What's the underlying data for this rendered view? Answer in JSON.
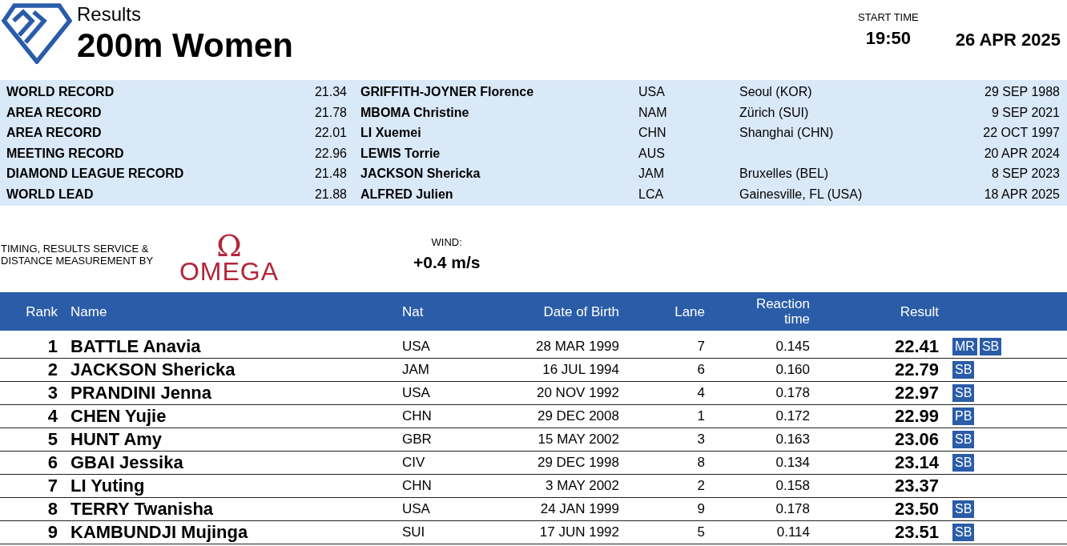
{
  "header": {
    "subtitle": "Results",
    "title": "200m Women",
    "start_time_label": "START TIME",
    "start_time": "19:50",
    "date": "26 APR 2025"
  },
  "records": [
    {
      "label": "WORLD RECORD",
      "mark": "21.34",
      "athlete": "GRIFFITH-JOYNER Florence",
      "nat": "USA",
      "venue": "Seoul (KOR)",
      "date": "29 SEP 1988"
    },
    {
      "label": "AREA RECORD",
      "mark": "21.78",
      "athlete": "MBOMA Christine",
      "nat": "NAM",
      "venue": "Zürich (SUI)",
      "date": "9 SEP 2021"
    },
    {
      "label": "AREA RECORD",
      "mark": "22.01",
      "athlete": "LI Xuemei",
      "nat": "CHN",
      "venue": "Shanghai (CHN)",
      "date": "22 OCT 1997"
    },
    {
      "label": "MEETING RECORD",
      "mark": "22.96",
      "athlete": "LEWIS Torrie",
      "nat": "AUS",
      "date": "20 APR 2024"
    },
    {
      "label": "DIAMOND LEAGUE RECORD",
      "mark": "21.48",
      "athlete": "JACKSON Shericka",
      "nat": "JAM",
      "venue": "Bruxelles (BEL)",
      "date": "8 SEP 2023"
    },
    {
      "label": "WORLD LEAD",
      "mark": "21.88",
      "athlete": "ALFRED Julien",
      "nat": "LCA",
      "venue": "Gainesville, FL (USA)",
      "date": "18 APR 2025"
    }
  ],
  "sponsor": {
    "text": "TIMING, RESULTS SERVICE & DISTANCE MEASUREMENT BY",
    "symbol": "Ω",
    "name": "OMEGA"
  },
  "wind": {
    "label": "WIND:",
    "value": "+0.4 m/s"
  },
  "table": {
    "columns": [
      "Rank",
      "Name",
      "Nat",
      "Date of Birth",
      "Lane",
      "Reaction time",
      "Result"
    ],
    "rows": [
      {
        "rank": "1",
        "name": "BATTLE Anavia",
        "nat": "USA",
        "dob": "28 MAR 1999",
        "lane": "7",
        "reaction": "0.145",
        "result": "22.41",
        "marks": [
          "MR",
          "SB"
        ]
      },
      {
        "rank": "2",
        "name": "JACKSON Shericka",
        "nat": "JAM",
        "dob": "16 JUL 1994",
        "lane": "6",
        "reaction": "0.160",
        "result": "22.79",
        "marks": [
          "SB"
        ]
      },
      {
        "rank": "3",
        "name": "PRANDINI Jenna",
        "nat": "USA",
        "dob": "20 NOV 1992",
        "lane": "4",
        "reaction": "0.178",
        "result": "22.97",
        "marks": [
          "SB"
        ]
      },
      {
        "rank": "4",
        "name": "CHEN Yujie",
        "nat": "CHN",
        "dob": "29 DEC 2008",
        "lane": "1",
        "reaction": "0.172",
        "result": "22.99",
        "marks": [
          "PB"
        ]
      },
      {
        "rank": "5",
        "name": "HUNT Amy",
        "nat": "GBR",
        "dob": "15 MAY 2002",
        "lane": "3",
        "reaction": "0.163",
        "result": "23.06",
        "marks": [
          "SB"
        ]
      },
      {
        "rank": "6",
        "name": "GBAI Jessika",
        "nat": "CIV",
        "dob": "29 DEC 1998",
        "lane": "8",
        "reaction": "0.134",
        "result": "23.14",
        "marks": [
          "SB"
        ]
      },
      {
        "rank": "7",
        "name": "LI Yuting",
        "nat": "CHN",
        "dob": "3 MAY 2002",
        "lane": "2",
        "reaction": "0.158",
        "result": "23.37"
      },
      {
        "rank": "8",
        "name": "TERRY Twanisha",
        "nat": "USA",
        "dob": "24 JAN 1999",
        "lane": "9",
        "reaction": "0.178",
        "result": "23.50",
        "marks": [
          "SB"
        ]
      },
      {
        "rank": "9",
        "name": "KAMBUNDJI Mujinga",
        "nat": "SUI",
        "dob": "17 JUN 1992",
        "lane": "5",
        "reaction": "0.114",
        "result": "23.51",
        "marks": [
          "SB"
        ]
      }
    ]
  }
}
